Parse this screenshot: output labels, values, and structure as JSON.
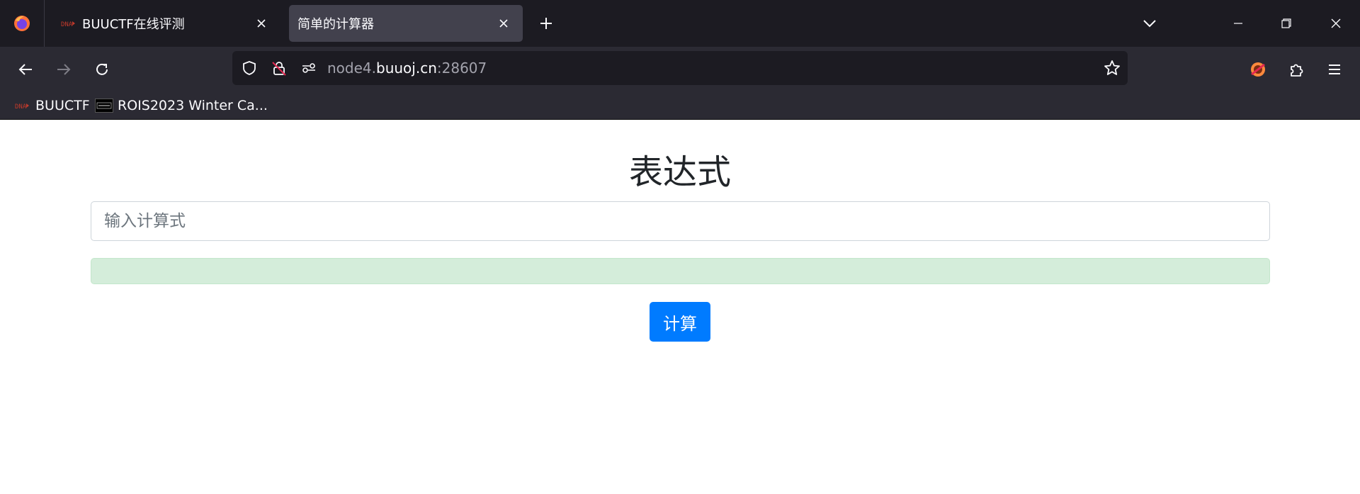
{
  "browser": {
    "tabs": [
      {
        "title": "BUUCTF在线评测",
        "favicon": "buuctf-favicon",
        "active": false
      },
      {
        "title": "简单的计算器",
        "favicon": "none",
        "active": true
      }
    ],
    "url": {
      "prefix": "node4.",
      "host": "buuoj.cn",
      "suffix": ":28607"
    },
    "bookmarks": [
      {
        "label": "BUUCTF",
        "icon": "buuctf-favicon"
      },
      {
        "label": "ROIS2023 Winter Ca...",
        "icon": "rois-favicon"
      }
    ],
    "icons": {
      "firefox": "firefox-icon",
      "new_tab": "plus-icon",
      "tab_list": "chevron-down-icon",
      "back": "arrow-left-icon",
      "forward": "arrow-right-icon",
      "reload": "reload-icon",
      "shield": "shield-icon",
      "insecure_lock": "lock-slash-icon",
      "permissions": "permissions-icon",
      "bookmark_star": "star-icon",
      "extension_1": "ublock-icon",
      "extensions": "puzzle-icon",
      "menu": "hamburger-icon"
    }
  },
  "page": {
    "heading": "表达式",
    "input": {
      "placeholder": "输入计算式",
      "value": ""
    },
    "result": "",
    "button_label": "计算"
  },
  "colors": {
    "chrome_dark": "#1c1b22",
    "chrome_mid": "#2b2a33",
    "active_tab": "#42414d",
    "result_bg": "#d4edda",
    "button_blue": "#007bff"
  }
}
